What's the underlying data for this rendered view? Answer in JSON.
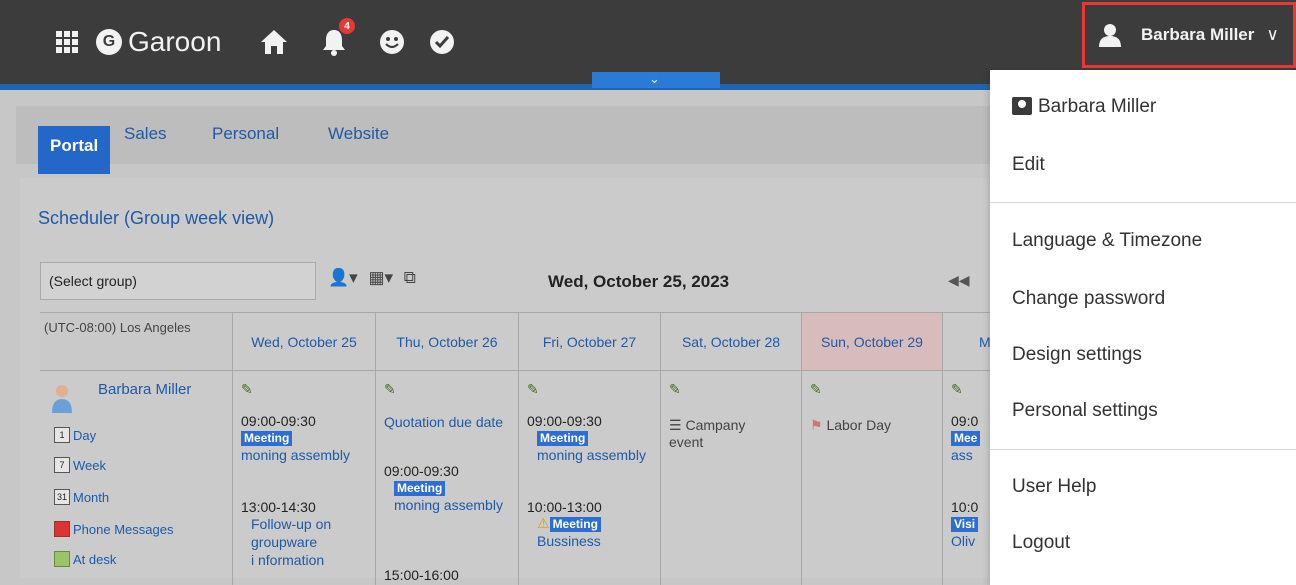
{
  "header": {
    "logo_text": "Garoon",
    "logo_letter": "G",
    "notification_count": "4",
    "user_name": "Barbara Miller",
    "caret": "∨"
  },
  "tabs": [
    {
      "label": "Portal",
      "active": true
    },
    {
      "label": "Sales"
    },
    {
      "label": "Personal"
    },
    {
      "label": "Website"
    }
  ],
  "scheduler": {
    "title": "Scheduler (Group week view)",
    "group_select": "(Select group)",
    "current_date": "Wed, October 25, 2023",
    "prev_symbol": "◀◀",
    "timezone": "(UTC-08:00) Los Angeles",
    "columns": [
      "Wed, October 25",
      "Thu, October 26",
      "Fri, October 27",
      "Sat, October 28",
      "Sun, October 29",
      "M"
    ],
    "user": {
      "name": "Barbara Miller",
      "links": [
        "Day",
        "Week",
        "Month",
        "Phone Messages",
        "At desk"
      ],
      "link_icons": [
        "1",
        "7",
        "31",
        "",
        ""
      ]
    },
    "wed": {
      "ev1_time": "09:00-09:30",
      "ev1_tag": "Meeting",
      "ev1_title": "moning assembly",
      "ev2_time": "13:00-14:30",
      "ev2_title": "Follow-up on groupware",
      "ev2_more": "i nformation"
    },
    "thu": {
      "ev1_title": "Quotation due date",
      "ev2_time": "09:00-09:30",
      "ev2_tag": "Meeting",
      "ev2_title": "moning assembly",
      "ev3_time": "15:00-16:00"
    },
    "fri": {
      "ev1_time": "09:00-09:30",
      "ev1_tag": "Meeting",
      "ev1_title": "moning assembly",
      "ev2_time": "10:00-13:00",
      "ev2_tag": "Meeting",
      "ev2_title": "Bussiness"
    },
    "sat": {
      "ev1_title": "Campany event"
    },
    "sun": {
      "ev1_title": "Labor Day"
    },
    "mon": {
      "ev1_time": "09:0",
      "ev1_tag": "Mee",
      "ev1_title": "ass",
      "ev2_time": "10:0",
      "ev2_tag": "Visi",
      "ev2_title": "Oliv"
    }
  },
  "menu": {
    "user": "Barbara Miller",
    "edit": "Edit",
    "language": "Language & Timezone",
    "password": "Change password",
    "design": "Design settings",
    "personal": "Personal settings",
    "help": "User Help",
    "logout": "Logout"
  }
}
